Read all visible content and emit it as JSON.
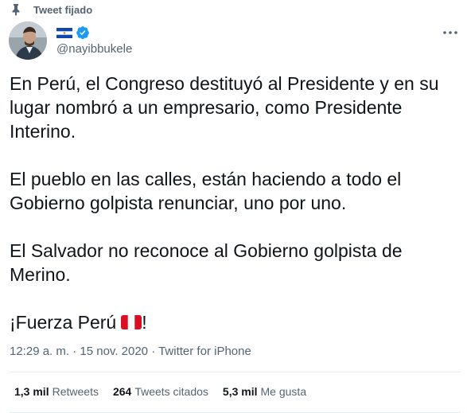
{
  "pinned": {
    "label": "Tweet fijado",
    "icon": "pin-icon"
  },
  "author": {
    "handle": "@nayibbukele",
    "flag_icon": "el-salvador-flag-icon",
    "verified_icon": "verified-badge-icon",
    "verified_color": "#1d9bf0"
  },
  "menu": {
    "icon": "more-options-icon"
  },
  "tweet": {
    "paragraphs": [
      "En Perú, el Congreso destituyó al Presidente y en su lugar nombró a un empresario, como Presidente Interino.",
      "El pueblo en las calles, están haciendo a todo el Gobierno golpista renunciar, uno por uno.",
      "El Salvador no reconoce al Gobierno golpista de Merino.",
      "¡Fuerza Perú"
    ],
    "closing_exclamation": "!",
    "flag_icon": "peru-flag-icon"
  },
  "meta": {
    "time": "12:29 a. m.",
    "separator": " · ",
    "date": "15 nov. 2020",
    "source": "Twitter for iPhone"
  },
  "stats": {
    "retweets": {
      "count": "1,3 mil",
      "label": "Retweets"
    },
    "quotes": {
      "count": "264",
      "label": "Tweets citados"
    },
    "likes": {
      "count": "5,3 mil",
      "label": "Me gusta"
    }
  },
  "colors": {
    "text": "#0f1419",
    "secondary": "#536471",
    "divider": "#e6ecf0",
    "peru_red": "#d91023"
  }
}
